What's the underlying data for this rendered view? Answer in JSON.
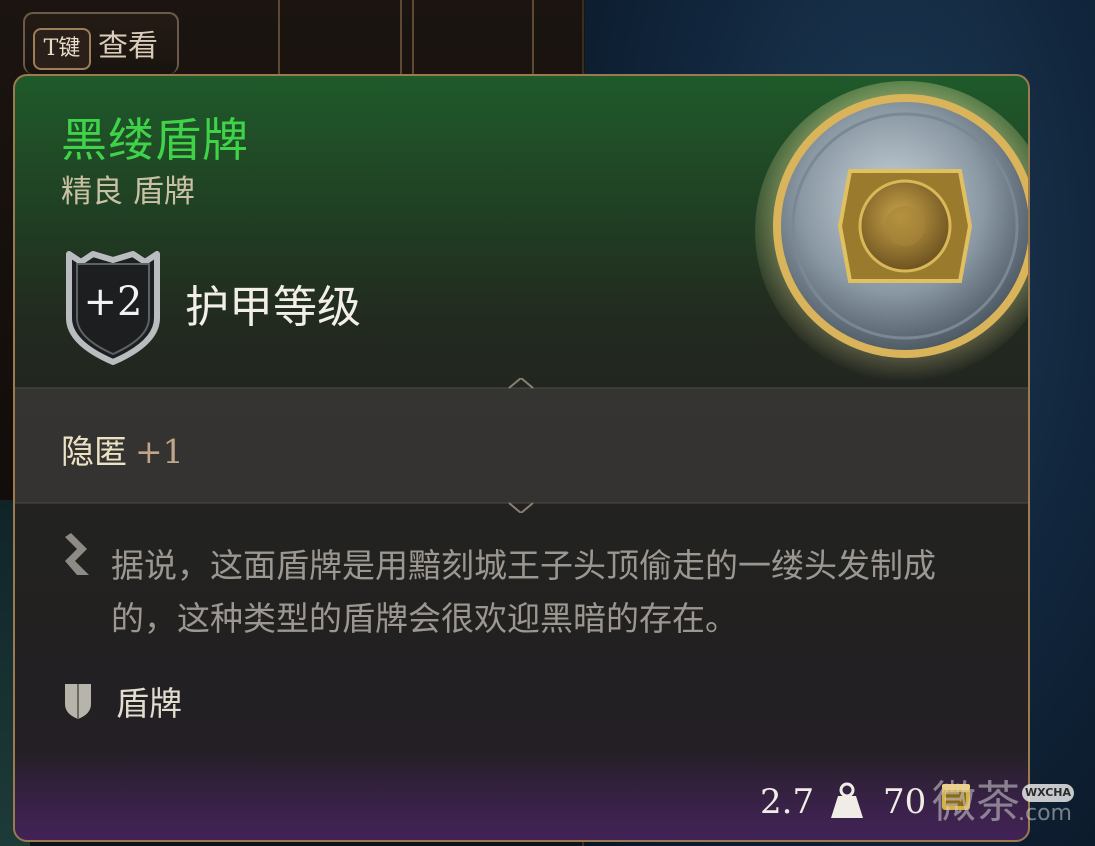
{
  "view_button": {
    "key": "T键",
    "label": "查看"
  },
  "item": {
    "name": "黑缕盾牌",
    "subtitle": "精良 盾牌",
    "armor_class_value": "+2",
    "armor_class_label": "护甲等级",
    "bonus": {
      "name": "隐匿",
      "value": "+1"
    },
    "description": "据说，这面盾牌是用黯刻城王子头顶偷走的一缕头发制成的，这种类型的盾牌会很欢迎黑暗的存在。",
    "type_label": "盾牌",
    "weight": "2.7",
    "price": "70",
    "icons": {
      "armor": "shield-icon",
      "lore": "quill-icon",
      "type": "shield-icon",
      "weight": "weight-icon",
      "price": "coin-icon"
    },
    "colors": {
      "name": "#3fd34a",
      "rarity_tint": "#1f5a2a",
      "border": "#9a7a4e"
    }
  },
  "watermark": {
    "text": "微茶",
    "badge": "WXCHA",
    "suffix": ".com"
  }
}
